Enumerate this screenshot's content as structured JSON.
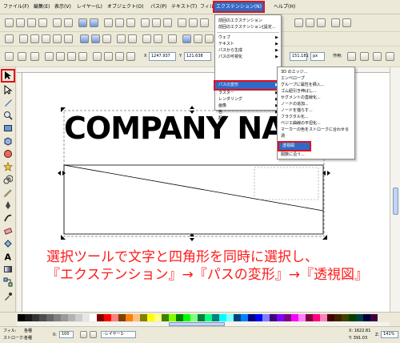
{
  "menubar": {
    "items": [
      "ファイル(F)",
      "編集(E)",
      "表示(V)",
      "レイヤー(L)",
      "オブジェクト(O)",
      "パス(P)",
      "テキスト(T)",
      "フィルタ(S)",
      "エクステンション(N)",
      "ヘルプ(H)"
    ]
  },
  "tool_controls": {
    "x_value": "1247.937",
    "y_value": "121.638",
    "h_value": "151.181",
    "unit": "px",
    "affect_label": "作用:"
  },
  "extensions_menu": {
    "items": [
      {
        "label": "前回のエクステンション",
        "submenu": false
      },
      {
        "label": "前回のエクステンション[設定...",
        "submenu": false
      },
      {
        "label": "ウェブ",
        "submenu": true
      },
      {
        "label": "テキスト",
        "submenu": true
      },
      {
        "label": "パスから生成",
        "submenu": true
      },
      {
        "label": "パスの可視化",
        "submenu": true
      },
      {
        "label": "パスの変形",
        "submenu": true
      },
      {
        "label": "ラスター",
        "submenu": true
      },
      {
        "label": "レンダリング",
        "submenu": true
      },
      {
        "label": "画像",
        "submenu": true
      },
      {
        "label": "色",
        "submenu": true
      },
      {
        "label": "配置",
        "submenu": true
      }
    ]
  },
  "path_transform_menu": {
    "items": [
      "3D のエッジ...",
      "エンベロープ",
      "グループに属性を挿入...",
      "ゴム紐引き伸ばし...",
      "セグメントの直線化...",
      "ノードの追加...",
      "ノードを揺らす...",
      "フラクタル化...",
      "ベジエ曲線の平坦化...",
      "マーカーの色をストロークに合わせる",
      "渦",
      "透視図",
      "関数に沿う..."
    ],
    "selected": "透視図"
  },
  "canvas": {
    "logo_text": "COMPANY NA",
    "instruction_line1": "選択ツールで文字と四角形を同時に選択し、",
    "instruction_line2": "『エクステンション』→『パスの変形』→『透視図』"
  },
  "status": {
    "fill_label": "フィル:",
    "stroke_label": "ストローク:",
    "fill_value": "各種",
    "stroke_value": "各種",
    "opacity_label": "0:",
    "opacity_value": "100",
    "layer": "-レイヤー1-",
    "coord_x": "X:  1622.81",
    "coord_y": "Y:   391.03",
    "zoom_label": "Z:",
    "zoom_value": "141%"
  },
  "colors": {
    "accent": "#316ac5",
    "annotation_red": "#ff1a1a",
    "outline_red": "#e0101e"
  }
}
